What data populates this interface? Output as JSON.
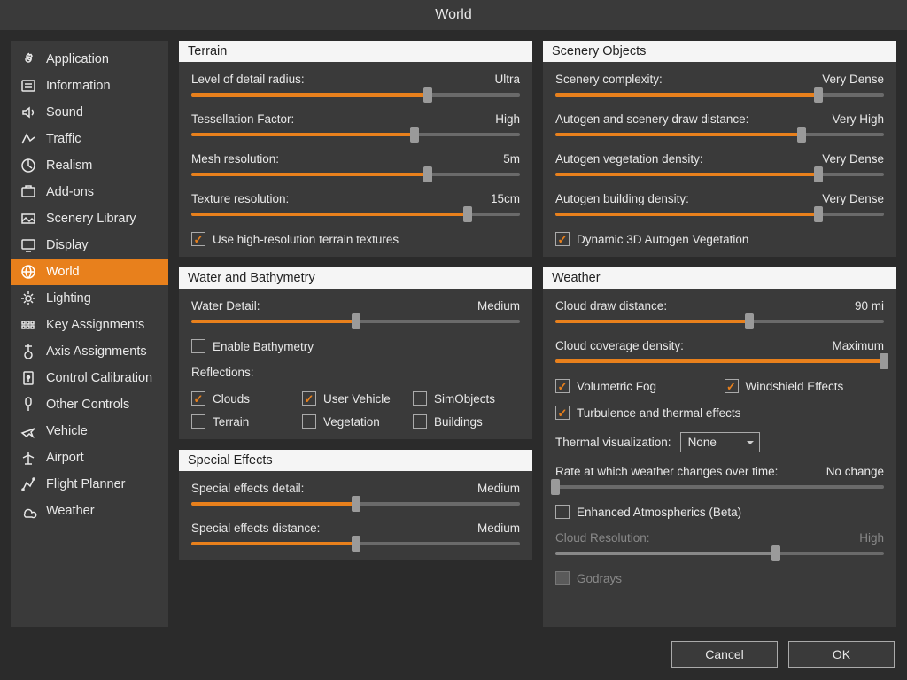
{
  "title": "World",
  "sidebar": {
    "items": [
      {
        "label": "Application",
        "icon": "gear"
      },
      {
        "label": "Information",
        "icon": "info"
      },
      {
        "label": "Sound",
        "icon": "sound"
      },
      {
        "label": "Traffic",
        "icon": "traffic"
      },
      {
        "label": "Realism",
        "icon": "realism"
      },
      {
        "label": "Add-ons",
        "icon": "addons"
      },
      {
        "label": "Scenery Library",
        "icon": "scenery"
      },
      {
        "label": "Display",
        "icon": "display"
      },
      {
        "label": "World",
        "icon": "world",
        "active": true
      },
      {
        "label": "Lighting",
        "icon": "lighting"
      },
      {
        "label": "Key Assignments",
        "icon": "keys"
      },
      {
        "label": "Axis Assignments",
        "icon": "axis"
      },
      {
        "label": "Control Calibration",
        "icon": "calibration"
      },
      {
        "label": "Other Controls",
        "icon": "other"
      },
      {
        "label": "Vehicle",
        "icon": "vehicle"
      },
      {
        "label": "Airport",
        "icon": "airport"
      },
      {
        "label": "Flight Planner",
        "icon": "planner"
      },
      {
        "label": "Weather",
        "icon": "weather"
      }
    ]
  },
  "panels": {
    "terrain": {
      "title": "Terrain",
      "sliders": [
        {
          "label": "Level of detail radius:",
          "value": "Ultra",
          "pct": 72
        },
        {
          "label": "Tessellation Factor:",
          "value": "High",
          "pct": 68
        },
        {
          "label": "Mesh resolution:",
          "value": "5m",
          "pct": 72
        },
        {
          "label": "Texture resolution:",
          "value": "15cm",
          "pct": 84
        }
      ],
      "hires": {
        "label": "Use high-resolution terrain textures",
        "checked": true
      }
    },
    "water": {
      "title": "Water and Bathymetry",
      "detail": {
        "label": "Water Detail:",
        "value": "Medium",
        "pct": 50
      },
      "bathy": {
        "label": "Enable Bathymetry",
        "checked": false
      },
      "reflections_label": "Reflections:",
      "reflections": [
        {
          "label": "Clouds",
          "checked": true
        },
        {
          "label": "User Vehicle",
          "checked": true
        },
        {
          "label": "SimObjects",
          "checked": false
        },
        {
          "label": "Terrain",
          "checked": false
        },
        {
          "label": "Vegetation",
          "checked": false
        },
        {
          "label": "Buildings",
          "checked": false
        }
      ]
    },
    "sfx": {
      "title": "Special Effects",
      "sliders": [
        {
          "label": "Special effects detail:",
          "value": "Medium",
          "pct": 50
        },
        {
          "label": "Special effects distance:",
          "value": "Medium",
          "pct": 50
        }
      ]
    },
    "scenery": {
      "title": "Scenery Objects",
      "sliders": [
        {
          "label": "Scenery complexity:",
          "value": "Very Dense",
          "pct": 80
        },
        {
          "label": "Autogen and scenery draw distance:",
          "value": "Very High",
          "pct": 75
        },
        {
          "label": "Autogen vegetation density:",
          "value": "Very Dense",
          "pct": 80
        },
        {
          "label": "Autogen building density:",
          "value": "Very Dense",
          "pct": 80
        }
      ],
      "dyn3d": {
        "label": "Dynamic 3D Autogen Vegetation",
        "checked": true
      }
    },
    "weather": {
      "title": "Weather",
      "cloud_dist": {
        "label": "Cloud draw distance:",
        "value": "90 mi",
        "pct": 59
      },
      "cloud_cov": {
        "label": "Cloud coverage density:",
        "value": "Maximum",
        "pct": 100
      },
      "volfog": {
        "label": "Volumetric Fog",
        "checked": true
      },
      "windshield": {
        "label": "Windshield Effects",
        "checked": true
      },
      "turbulence": {
        "label": "Turbulence and thermal effects",
        "checked": true
      },
      "thermal_vis": {
        "label": "Thermal visualization:",
        "value": "None"
      },
      "rate": {
        "label": "Rate at which weather changes over time:",
        "value": "No change",
        "pct": 0
      },
      "enh_atmo": {
        "label": "Enhanced Atmospherics (Beta)",
        "checked": false
      },
      "cloud_res": {
        "label": "Cloud Resolution:",
        "value": "High",
        "pct": 67
      },
      "godrays": {
        "label": "Godrays",
        "checked": false
      }
    }
  },
  "footer": {
    "cancel": "Cancel",
    "ok": "OK"
  }
}
